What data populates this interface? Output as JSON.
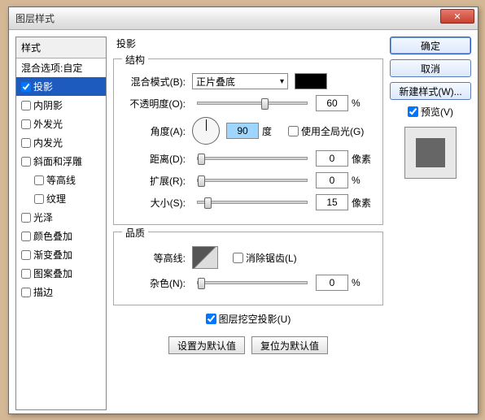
{
  "window": {
    "title": "图层样式"
  },
  "left": {
    "header": "样式",
    "items": [
      {
        "label": "混合选项:自定",
        "checkbox": false
      },
      {
        "label": "投影",
        "checked": true,
        "selected": true
      },
      {
        "label": "内阴影",
        "checked": false
      },
      {
        "label": "外发光",
        "checked": false
      },
      {
        "label": "内发光",
        "checked": false
      },
      {
        "label": "斜面和浮雕",
        "checked": false
      },
      {
        "label": "等高线",
        "checked": false,
        "indent": true
      },
      {
        "label": "纹理",
        "checked": false,
        "indent": true
      },
      {
        "label": "光泽",
        "checked": false
      },
      {
        "label": "颜色叠加",
        "checked": false
      },
      {
        "label": "渐变叠加",
        "checked": false
      },
      {
        "label": "图案叠加",
        "checked": false
      },
      {
        "label": "描边",
        "checked": false
      }
    ]
  },
  "center": {
    "title": "投影",
    "struct_label": "结构",
    "blend_label": "混合模式(B):",
    "blend_value": "正片叠底",
    "opacity_label": "不透明度(O):",
    "opacity_value": "60",
    "opacity_unit": "%",
    "angle_label": "角度(A):",
    "angle_value": "90",
    "angle_unit": "度",
    "global_light_label": "使用全局光(G)",
    "distance_label": "距离(D):",
    "distance_value": "0",
    "distance_unit": "像素",
    "spread_label": "扩展(R):",
    "spread_value": "0",
    "spread_unit": "%",
    "size_label": "大小(S):",
    "size_value": "15",
    "size_unit": "像素",
    "quality_label": "品质",
    "contour_label": "等高线:",
    "antialiased_label": "消除锯齿(L)",
    "noise_label": "杂色(N):",
    "noise_value": "0",
    "noise_unit": "%",
    "knockout_label": "图层挖空投影(U)",
    "set_default": "设置为默认值",
    "reset_default": "复位为默认值"
  },
  "right": {
    "ok": "确定",
    "cancel": "取消",
    "new_style": "新建样式(W)...",
    "preview_label": "预览(V)"
  }
}
